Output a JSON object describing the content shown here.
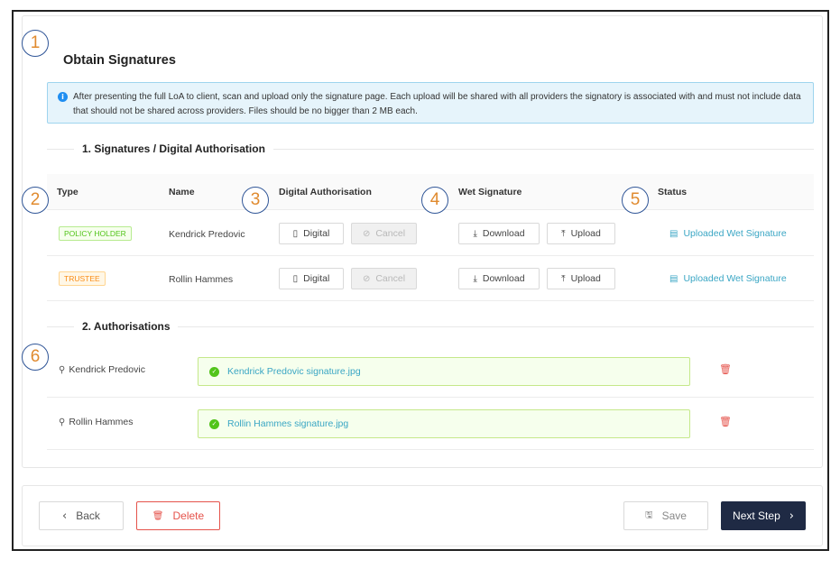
{
  "title": "Obtain Signatures",
  "callouts": [
    "1",
    "2",
    "3",
    "4",
    "5",
    "6"
  ],
  "info": {
    "icon": "info-icon",
    "text": "After presenting the full LoA to client, scan and upload only the signature page. Each upload will be shared with all providers the signatory is associated with and must not include data that should not be shared across providers. Files should be no bigger than 2 MB each."
  },
  "section1": {
    "title": "1. Signatures / Digital Authorisation",
    "columns": [
      "Type",
      "Name",
      "Digital Authorisation",
      "Wet Signature",
      "Status"
    ],
    "rows": [
      {
        "type": "POLICY HOLDER",
        "type_color": "green",
        "name": "Kendrick Predovic",
        "digital": "Digital",
        "cancel": "Cancel",
        "download": "Download",
        "upload": "Upload",
        "status": "Uploaded Wet Signature"
      },
      {
        "type": "TRUSTEE",
        "type_color": "orange",
        "name": "Rollin Hammes",
        "digital": "Digital",
        "cancel": "Cancel",
        "download": "Download",
        "upload": "Upload",
        "status": "Uploaded Wet Signature"
      }
    ]
  },
  "section2": {
    "title": "2. Authorisations",
    "rows": [
      {
        "person": "Kendrick Predovic",
        "file": "Kendrick Predovic signature.jpg"
      },
      {
        "person": "Rollin Hammes",
        "file": "Rollin Hammes signature.jpg"
      }
    ]
  },
  "footer": {
    "back": "Back",
    "delete": "Delete",
    "save": "Save",
    "next": "Next Step"
  },
  "colors": {
    "primary": "#1f2a44",
    "danger": "#e5534b",
    "link": "#3aa6c4",
    "success": "#52c41a"
  }
}
